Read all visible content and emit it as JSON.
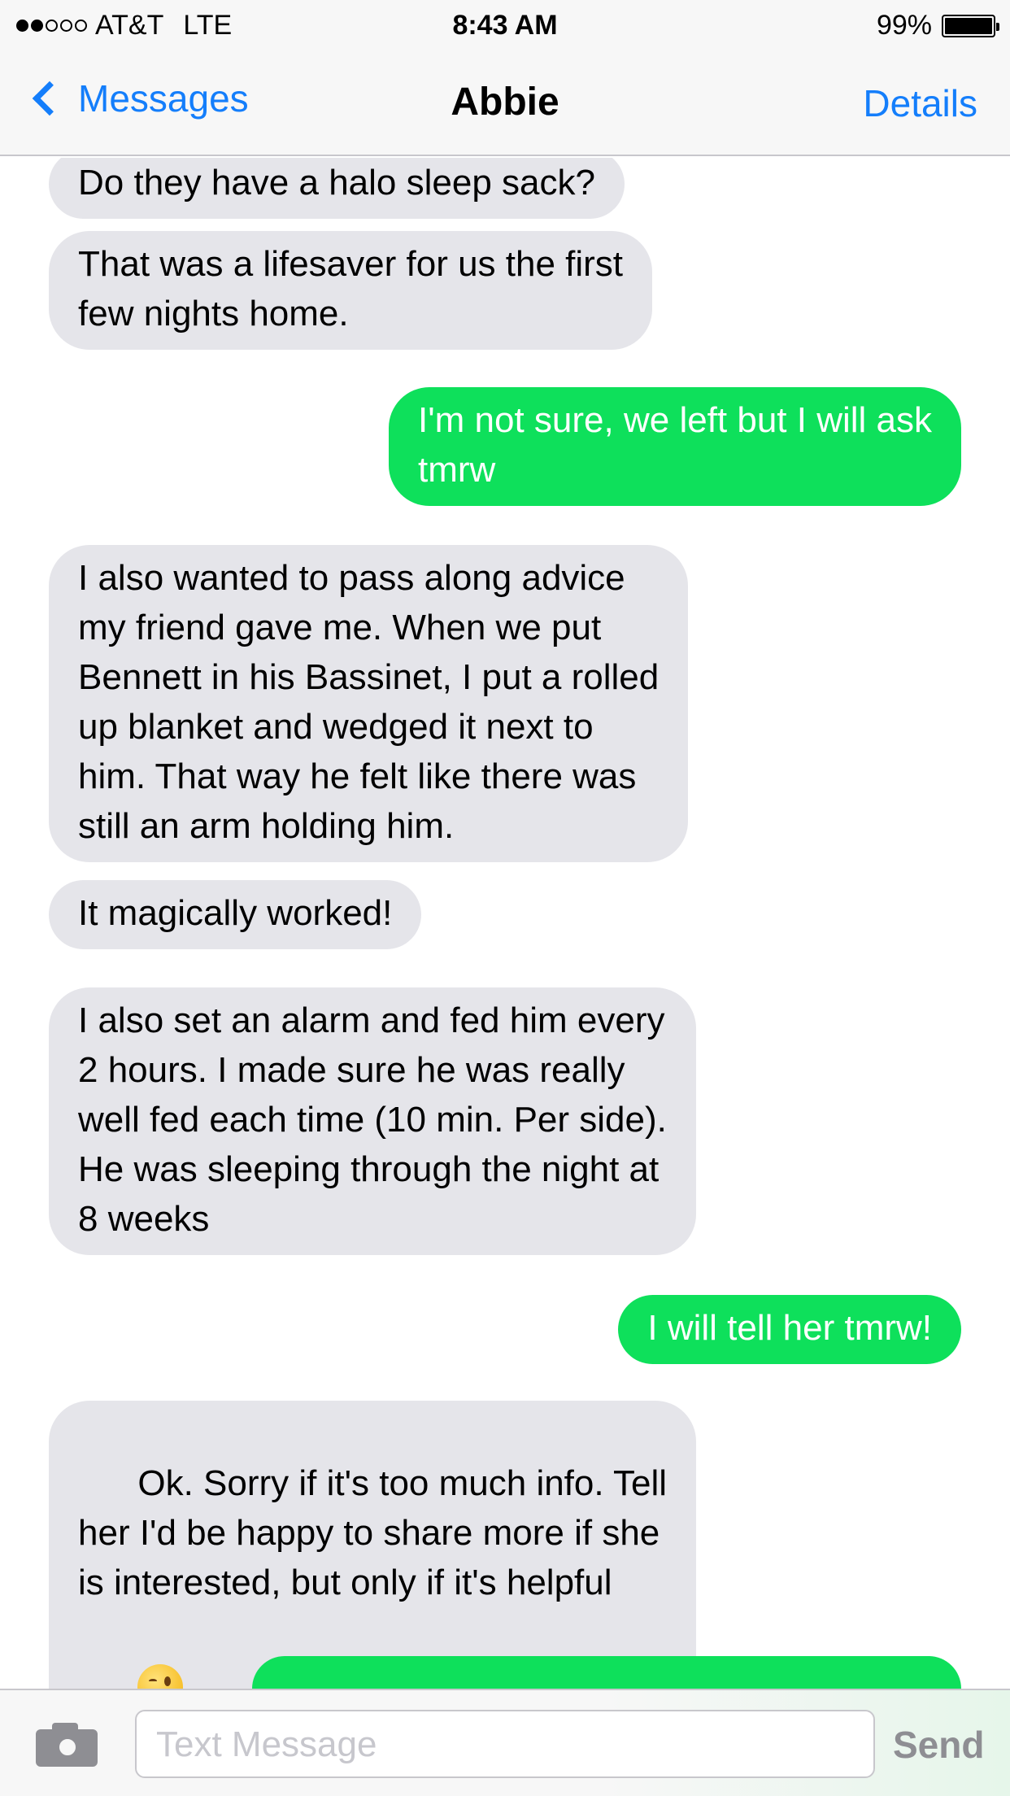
{
  "status_bar": {
    "carrier": "AT&T",
    "network": "LTE",
    "time": "8:43 AM",
    "battery": "99%"
  },
  "nav": {
    "back_label": "Messages",
    "title": "Abbie",
    "details_label": "Details"
  },
  "messages": [
    {
      "from": "them",
      "text": "Do they have a halo sleep sack?"
    },
    {
      "from": "them",
      "text": "That was a lifesaver for us the first\nfew nights home."
    },
    {
      "from": "me",
      "text": "I'm not sure, we left but I will ask\ntmrw"
    },
    {
      "from": "them",
      "text": "I also wanted to pass along advice\nmy friend gave me. When we put\nBennett in his Bassinet, I put a rolled\nup blanket and wedged it next to\nhim. That way he felt like there was\nstill an arm holding him."
    },
    {
      "from": "them",
      "text": "It magically worked!"
    },
    {
      "from": "them",
      "text": "I also set an alarm and fed him every\n2 hours. I made sure he was really\nwell fed each time (10 min. Per side).\nHe was sleeping through the night at\n8 weeks"
    },
    {
      "from": "me",
      "text": "I will tell her tmrw!"
    },
    {
      "from": "them",
      "text": "Ok. Sorry if it's too much info. Tell\nher I'd be happy to share more if she\nis interested, but only if it's helpful",
      "emoji": "winking-face-icon"
    }
  ],
  "input": {
    "placeholder": "Text Message",
    "send_label": "Send"
  },
  "colors": {
    "accent": "#147efb",
    "outgoing_bubble": "#0ee05b",
    "incoming_bubble": "#e5e5ea"
  }
}
